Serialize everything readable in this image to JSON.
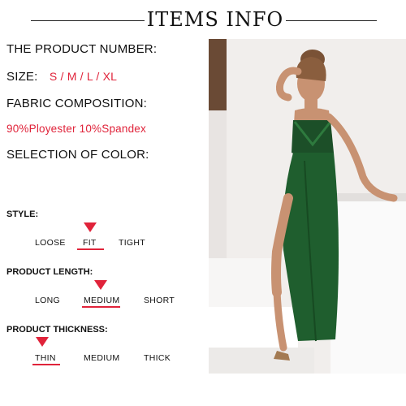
{
  "header": {
    "title": "ITEMS INFO"
  },
  "info": {
    "product_number_label": "THE PRODUCT NUMBER:",
    "size_label": "SIZE:",
    "size_values": "S / M / L / XL",
    "fabric_label": "FABRIC COMPOSITION:",
    "fabric_value": "90%Ployester 10%Spandex",
    "color_label": "SELECTION OF COLOR:"
  },
  "style": {
    "label": "STYLE:",
    "options": [
      "LOOSE",
      "FIT",
      "TIGHT"
    ],
    "selected": "FIT"
  },
  "length": {
    "label": "PRODUCT LENGTH:",
    "options": [
      "LONG",
      "MEDIUM",
      "SHORT"
    ],
    "selected": "MEDIUM"
  },
  "thickness": {
    "label": "PRODUCT THICKNESS:",
    "options": [
      "THIN",
      "MEDIUM",
      "THICK"
    ],
    "selected": "THIN"
  },
  "colors": {
    "accent": "#e0233a",
    "dress": "#1f5e2e"
  }
}
